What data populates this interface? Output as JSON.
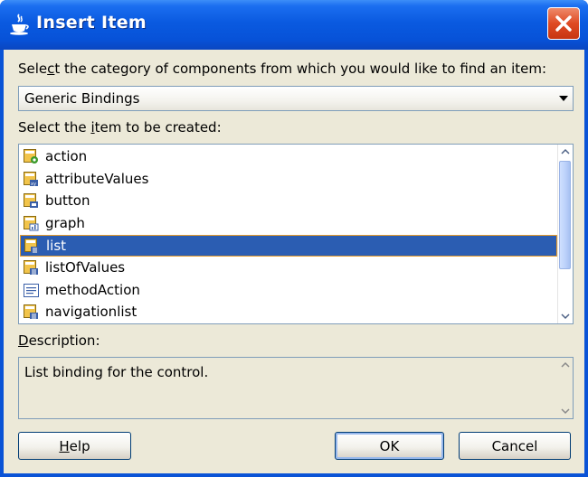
{
  "window": {
    "title": "Insert Item",
    "title_icon": "java-cup-icon",
    "close_icon": "close-icon"
  },
  "category": {
    "label_before": "Sele",
    "label_mnemonic": "c",
    "label_after": "t the category of components from which you would like to find an item:",
    "selected": "Generic Bindings"
  },
  "items": {
    "label_before": "Select the ",
    "label_mnemonic": "i",
    "label_after": "tem to be created:",
    "list": [
      {
        "label": "action",
        "icon": "action-binding-icon"
      },
      {
        "label": "attributeValues",
        "icon": "attribute-binding-icon"
      },
      {
        "label": "button",
        "icon": "button-binding-icon"
      },
      {
        "label": "graph",
        "icon": "graph-binding-icon"
      },
      {
        "label": "list",
        "icon": "list-binding-icon",
        "selected": true
      },
      {
        "label": "listOfValues",
        "icon": "list-binding-icon"
      },
      {
        "label": "methodAction",
        "icon": "method-binding-icon"
      },
      {
        "label": "navigationlist",
        "icon": "list-binding-icon"
      }
    ]
  },
  "description": {
    "label_mnemonic": "D",
    "label_after": "escription:",
    "text": "List binding for the control."
  },
  "buttons": {
    "help_mnemonic": "H",
    "help_after": "elp",
    "ok": "OK",
    "cancel": "Cancel"
  },
  "colors": {
    "titlebar": "#0a5ae0",
    "selection": "#2b5db2",
    "selection_border": "#e49b2d",
    "dialog_bg": "#ece9d8"
  }
}
